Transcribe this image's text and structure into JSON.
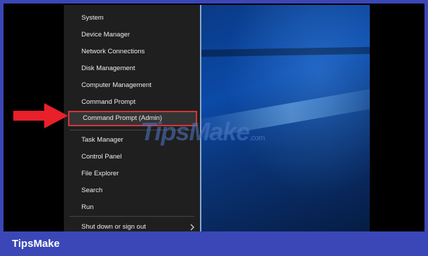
{
  "menu": {
    "items": [
      {
        "label": "System"
      },
      {
        "label": "Device Manager"
      },
      {
        "label": "Network Connections"
      },
      {
        "label": "Disk Management"
      },
      {
        "label": "Computer Management"
      },
      {
        "label": "Command Prompt"
      },
      {
        "label": "Command Prompt (Admin)"
      },
      {
        "label": "Task Manager"
      },
      {
        "label": "Control Panel"
      },
      {
        "label": "File Explorer"
      },
      {
        "label": "Search"
      },
      {
        "label": "Run"
      },
      {
        "label": "Shut down or sign out"
      }
    ],
    "highlighted_index": 6
  },
  "watermark": {
    "main": "TipsMake",
    "suffix": ".com"
  },
  "footer": {
    "brand": "TipsMake"
  },
  "colors": {
    "page_background": "#3b47b6",
    "menu_background": "#1f1f1f",
    "highlight_border": "#d2353b",
    "arrow": "#e8202a"
  },
  "icons": [
    "red-arrow-icon",
    "chevron-right-icon"
  ]
}
